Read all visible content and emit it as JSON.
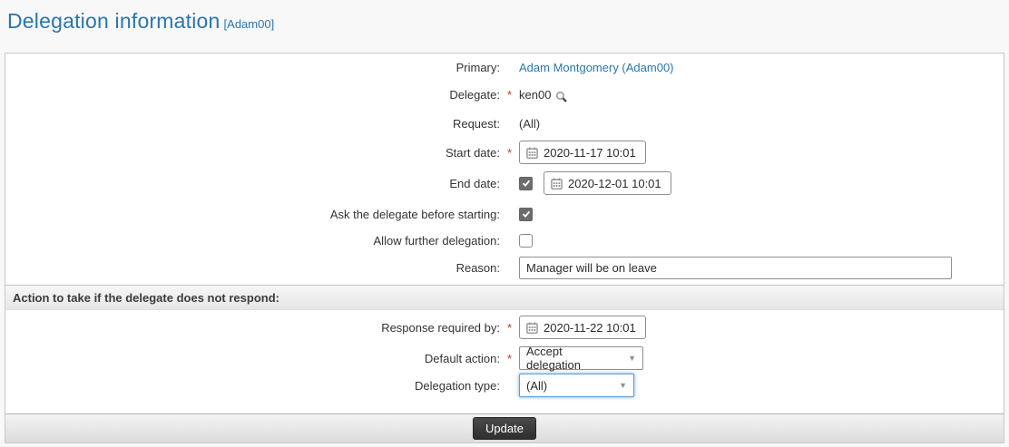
{
  "header": {
    "title": "Delegation information",
    "title_ref": "[Adam00]"
  },
  "fields": {
    "primary": {
      "label": "Primary:",
      "value": "Adam Montgomery (Adam00)"
    },
    "delegate": {
      "label": "Delegate:",
      "required": "*",
      "value": "ken00"
    },
    "request": {
      "label": "Request:",
      "value": "(All)"
    },
    "start_date": {
      "label": "Start date:",
      "required": "*",
      "value": "2020-11-17 10:01"
    },
    "end_date": {
      "label": "End date:",
      "checked": true,
      "value": "2020-12-01 10:01"
    },
    "ask_before": {
      "label": "Ask the delegate before starting:",
      "checked": true
    },
    "allow_further": {
      "label": "Allow further delegation:",
      "checked": false
    },
    "reason": {
      "label": "Reason:",
      "value": "Manager will be on leave"
    }
  },
  "section": {
    "title": "Action to take if the delegate does not respond:"
  },
  "action_fields": {
    "response_by": {
      "label": "Response required by:",
      "required": "*",
      "value": "2020-11-22 10:01"
    },
    "default_action": {
      "label": "Default action:",
      "required": "*",
      "value": "Accept delegation"
    },
    "delegation_type": {
      "label": "Delegation type:",
      "value": "(All)",
      "focused": true
    }
  },
  "footer": {
    "update_label": "Update"
  },
  "colors": {
    "title_blue": "#2a76ad",
    "link_blue": "#2a76ad",
    "required_red": "#c0392b",
    "focus_blue": "#5e9ed6",
    "button_dark": "#3a3a3a"
  }
}
